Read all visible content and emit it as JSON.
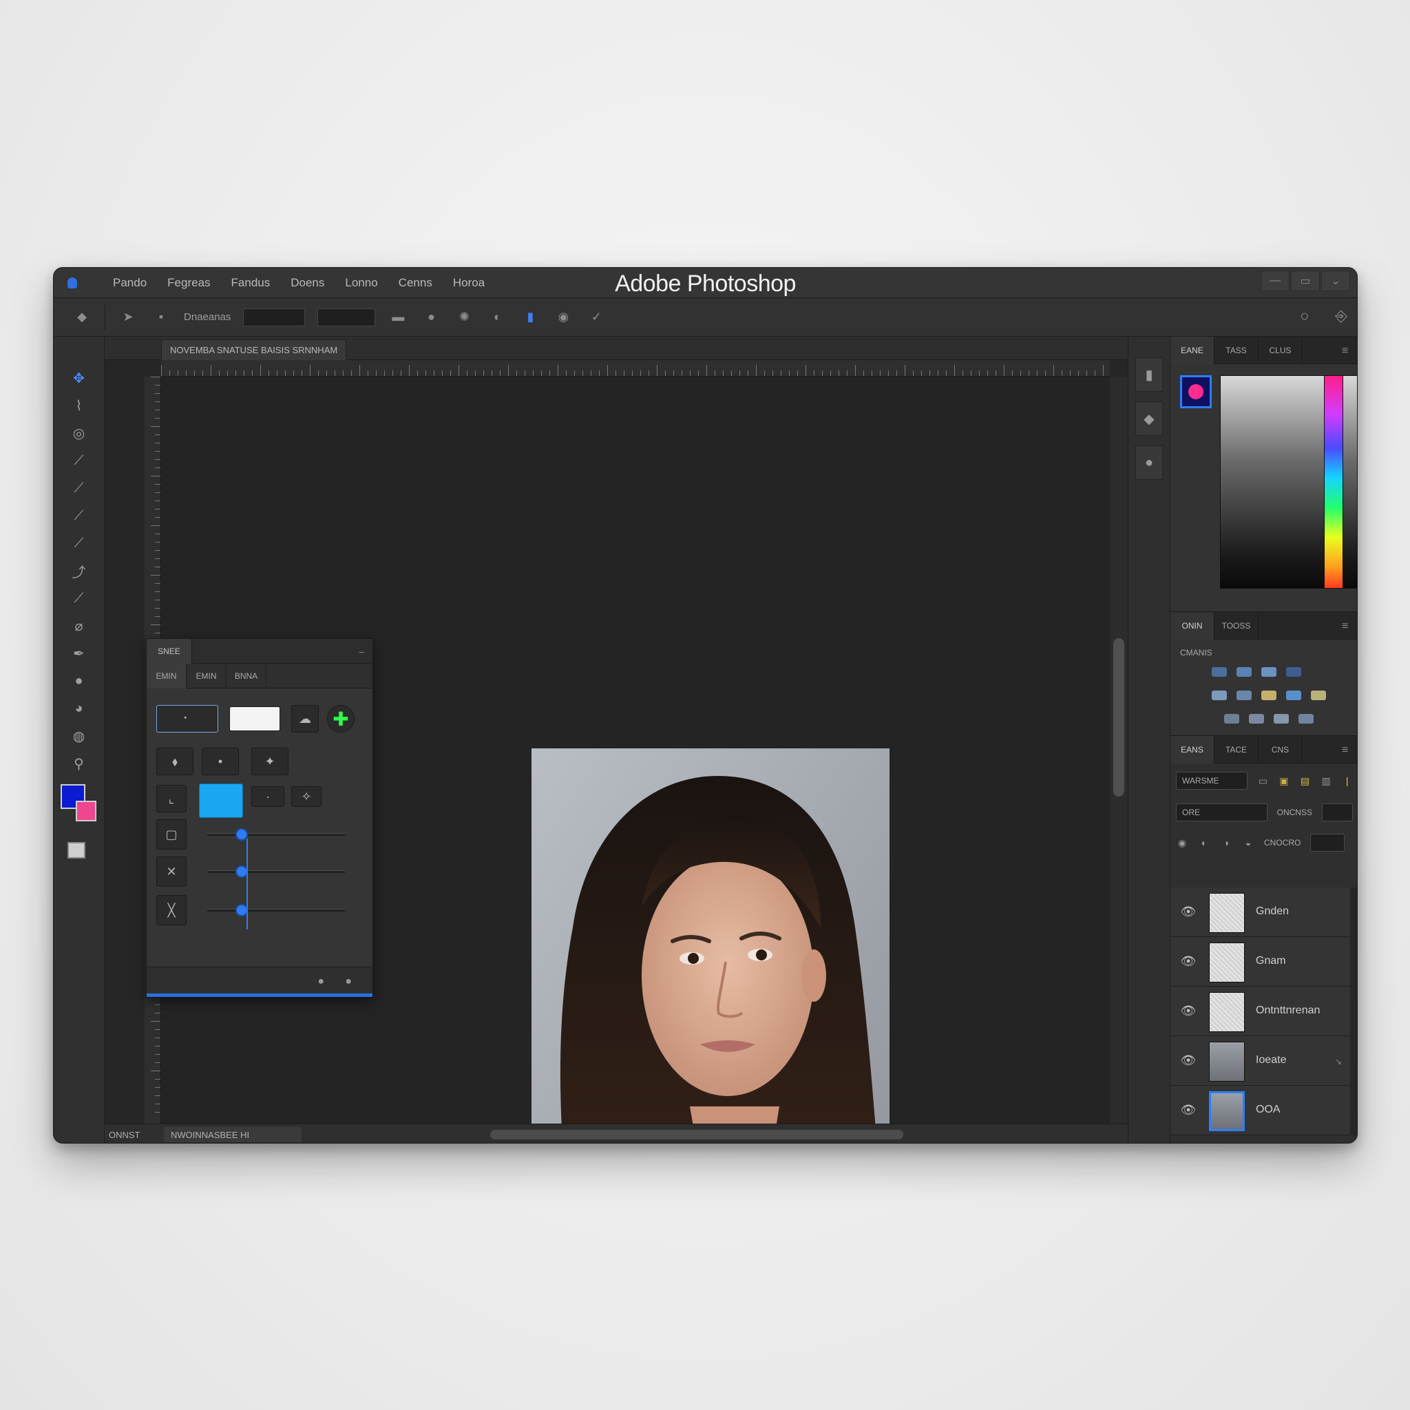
{
  "window": {
    "title": "Adobe Photoshop",
    "controls": {
      "minimize": "—",
      "maximize": "▭",
      "close": "⌄"
    }
  },
  "menu": [
    "Pando",
    "Fegreas",
    "Fandus",
    "Doens",
    "Lonno",
    "Cenns",
    "Horoa"
  ],
  "optionsbar": {
    "label": "Dnaeanas",
    "field1": "",
    "field2": "",
    "icons": [
      "move-icon",
      "cursor-icon",
      "lock-icon",
      "brush-icon",
      "circle-icon",
      "gear-icon",
      "sun-icon",
      "bookmark-icon",
      "eye-icon",
      "check-icon",
      "circle-outline-icon",
      "share-icon"
    ]
  },
  "document": {
    "tab_label": "NOVEMBA SNATUSE  BAISIS SRNNHAM",
    "zoom": "ONNST",
    "info": "NWOINNASBEE HI"
  },
  "properties_panel": {
    "title": "SNEE",
    "tabs": [
      "EMIN",
      "EMIN",
      "BNNA"
    ],
    "slider_values": [
      0.25,
      0.25,
      0.25
    ]
  },
  "color_panel": {
    "tabs": [
      "EANE",
      "TASS",
      "CLUS"
    ],
    "foreground": "#0a1bd2",
    "background": "#f0458f",
    "chip_color": "#ff2b8f"
  },
  "swatches_panel": {
    "tabs": [
      "ONIN",
      "TOOSS"
    ],
    "label": "CMANIS"
  },
  "layers_panel": {
    "tabs": [
      "EANS",
      "TACE",
      "CNS"
    ],
    "filter_label": "WARSME",
    "blend_mode": "ORE",
    "opacity_label": "ONCNSS",
    "fill_label": "CNOCRO",
    "layers": [
      {
        "name": "Gnden",
        "thumb": "pattern",
        "extra": ""
      },
      {
        "name": "Gnam",
        "thumb": "pattern",
        "extra": ""
      },
      {
        "name": "Ontnttnrenan",
        "thumb": "pattern",
        "extra": ""
      },
      {
        "name": "Ioeate",
        "thumb": "photo",
        "extra": "↘"
      },
      {
        "name": "OOA",
        "thumb": "photo-selected",
        "extra": ""
      }
    ]
  }
}
